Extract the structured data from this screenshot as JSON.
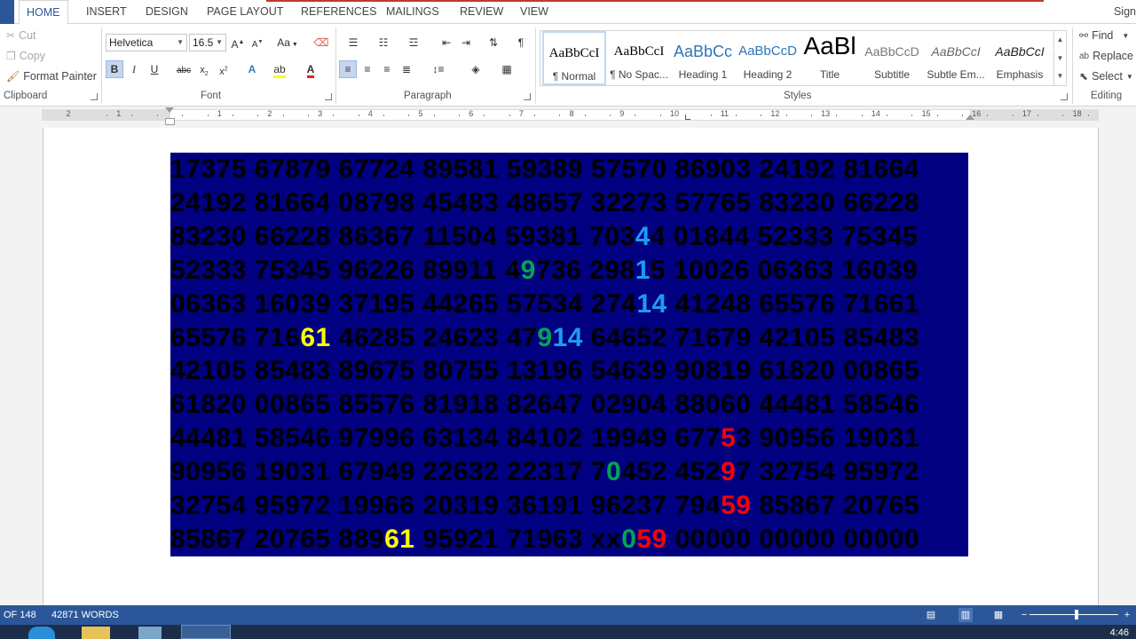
{
  "tabs": [
    "HOME",
    "INSERT",
    "DESIGN",
    "PAGE LAYOUT",
    "REFERENCES",
    "MAILINGS",
    "REVIEW",
    "VIEW"
  ],
  "sign_in": "Sign",
  "clipboard": {
    "cut": "Cut",
    "copy": "Copy",
    "format_painter": "Format Painter",
    "label": "Clipboard"
  },
  "font": {
    "name": "Helvetica",
    "size": "16.5",
    "change_case": "Aa",
    "label": "Font"
  },
  "paragraph": {
    "label": "Paragraph"
  },
  "styles": {
    "label": "Styles",
    "items": [
      {
        "preview": "AaBbCcI",
        "name": "¶ Normal"
      },
      {
        "preview": "AaBbCcI",
        "name": "¶ No Spac..."
      },
      {
        "preview": "AaBbCc",
        "name": "Heading 1"
      },
      {
        "preview": "AaBbCcD",
        "name": "Heading 2"
      },
      {
        "preview": "AaBl",
        "name": "Title"
      },
      {
        "preview": "AaBbCcD",
        "name": "Subtitle"
      },
      {
        "preview": "AaBbCcI",
        "name": "Subtle Em..."
      },
      {
        "preview": "AaBbCcI",
        "name": "Emphasis"
      }
    ]
  },
  "editing": {
    "find": "Find",
    "replace": "Replace",
    "select": "Select",
    "label": "Editing"
  },
  "ruler_numbers": [
    "2",
    "1",
    "1",
    "2",
    "3",
    "4",
    "5",
    "6",
    "7",
    "8",
    "9",
    "10",
    "11",
    "12",
    "13",
    "14",
    "15",
    "16",
    "17",
    "18"
  ],
  "doc_rows": [
    [
      {
        "t": "17375 67879 67724 89581 59389 57570 86903 24192 81664"
      }
    ],
    [
      {
        "t": "24192 81664 08798 45483 48657 32273 57765 83230 66228"
      }
    ],
    [
      {
        "t": "83230 66228 86367 11504 59381 703"
      },
      {
        "t": "4",
        "c": "blue"
      },
      {
        "t": "4 01844 52333 75345"
      }
    ],
    [
      {
        "t": "52333 75345 96226 89911 4"
      },
      {
        "t": "9",
        "c": "green"
      },
      {
        "t": "736 298"
      },
      {
        "t": "1",
        "c": "blue"
      },
      {
        "t": "5 10026 06363 16039"
      }
    ],
    [
      {
        "t": "06363 16039 37195 44265 57534 274"
      },
      {
        "t": "14",
        "c": "blue"
      },
      {
        "t": " 41248 65576 71661"
      }
    ],
    [
      {
        "t": "65576 716"
      },
      {
        "t": "61",
        "c": "yellow"
      },
      {
        "t": " 46285 24623 47"
      },
      {
        "t": "9",
        "c": "green"
      },
      {
        "t": "14",
        "c": "blue"
      },
      {
        "t": " 64652 71679 42105 85483"
      }
    ],
    [
      {
        "t": "42105 85483 89675 80755 13196 54639 90819 61820 00865"
      }
    ],
    [
      {
        "t": "61820 00865 85576 81918 82647 02904 88060 44481 58546"
      }
    ],
    [
      {
        "t": "44481 58546 97996 63134 84102 19949 677"
      },
      {
        "t": "5",
        "c": "red"
      },
      {
        "t": "3 90956 19031"
      }
    ],
    [
      {
        "t": "90956 19031 67949 22632 22317 7"
      },
      {
        "t": "0",
        "c": "green"
      },
      {
        "t": "452 452"
      },
      {
        "t": "9",
        "c": "red"
      },
      {
        "t": "7 32754 95972"
      }
    ],
    [
      {
        "t": "32754 95972 19966 20319 36191 96237 794"
      },
      {
        "t": "59",
        "c": "red"
      },
      {
        "t": " 85867 20765"
      }
    ],
    [
      {
        "t": "85867 20765 889"
      },
      {
        "t": "61",
        "c": "yellow"
      },
      {
        "t": " 95921 71963 xx"
      },
      {
        "t": "0",
        "c": "green"
      },
      {
        "t": "59",
        "c": "red"
      },
      {
        "t": " 00000 00000 00000"
      }
    ]
  ],
  "status": {
    "page": "OF 148",
    "words": "42871 WORDS"
  },
  "clock": "4:46",
  "colors": {
    "accent": "#2b579a",
    "doc_bg": "#000080",
    "yellow": "#ffff00",
    "green": "#00a651",
    "blue": "#1e9bf0",
    "red": "#ff0000"
  }
}
